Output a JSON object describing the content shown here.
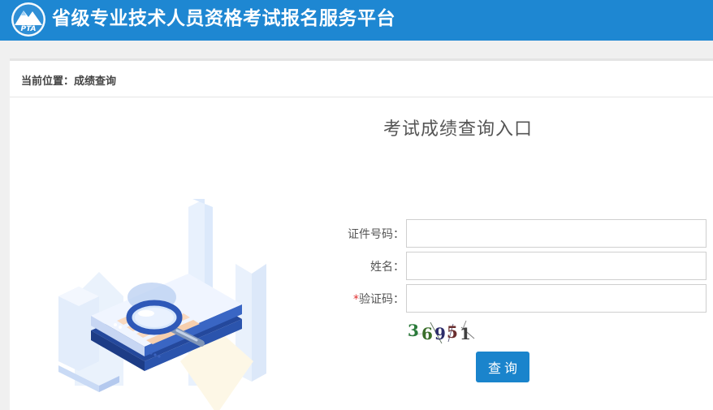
{
  "header": {
    "title": "省级专业技术人员资格考试报名服务平台",
    "logo_text": "PTA",
    "logo_icon": "mountain-logo-icon",
    "bg_color": "#1e87d2"
  },
  "breadcrumb": {
    "text": "当前位置：成绩查询"
  },
  "form": {
    "title": "考试成绩查询入口",
    "id_label": "证件号码：",
    "name_label": "姓名：",
    "captcha_required_mark": "*",
    "captcha_label": "验证码：",
    "id_value": "",
    "name_value": "",
    "captcha_value": "",
    "captcha_image_text": [
      "3",
      "6",
      "9",
      "5",
      "1"
    ],
    "submit_label": "查询",
    "button_color": "#1a84cc"
  },
  "illustration": {
    "icon": "magnifier-document-illustration"
  }
}
